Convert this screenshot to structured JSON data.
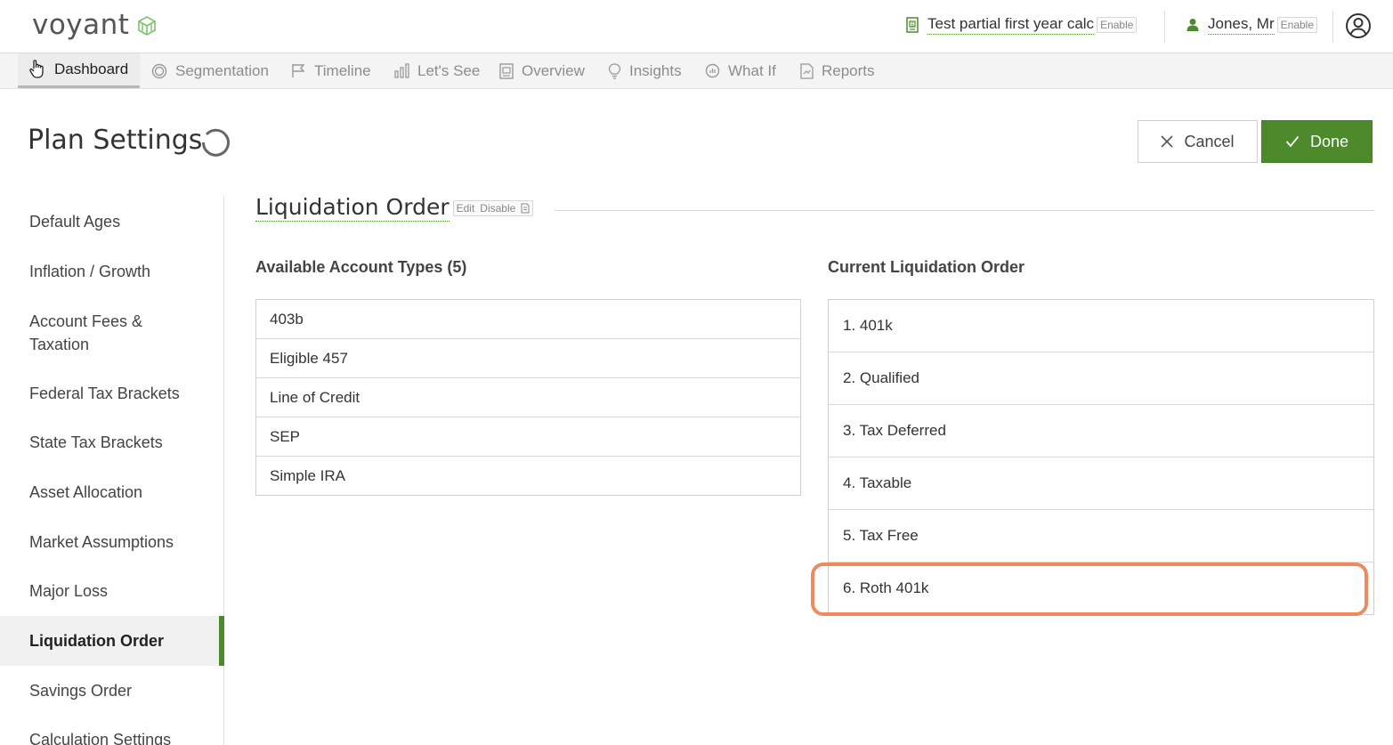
{
  "brand": {
    "name": "voyant"
  },
  "header": {
    "plan_name": "Test partial first year calc",
    "plan_enable": "Enable",
    "client_name": "Jones, Mr",
    "client_enable": "Enable"
  },
  "nav": {
    "tabs": [
      {
        "label": "Dashboard",
        "icon": "cursor-hand-icon",
        "active": true
      },
      {
        "label": "Segmentation",
        "icon": "segmentation-icon"
      },
      {
        "label": "Timeline",
        "icon": "flag-icon"
      },
      {
        "label": "Let's See",
        "icon": "bar-chart-icon"
      },
      {
        "label": "Overview",
        "icon": "overview-icon"
      },
      {
        "label": "Insights",
        "icon": "lightbulb-icon"
      },
      {
        "label": "What If",
        "icon": "what-if-icon"
      },
      {
        "label": "Reports",
        "icon": "document-icon"
      }
    ]
  },
  "page": {
    "title": "Plan Settings",
    "cancel_label": "Cancel",
    "done_label": "Done"
  },
  "sidebar": {
    "items": [
      {
        "label": "Default Ages"
      },
      {
        "label": "Inflation / Growth"
      },
      {
        "label": "Account Fees & Taxation"
      },
      {
        "label": "Federal Tax Brackets"
      },
      {
        "label": "State Tax Brackets"
      },
      {
        "label": "Asset Allocation"
      },
      {
        "label": "Market Assumptions"
      },
      {
        "label": "Major Loss"
      },
      {
        "label": "Liquidation Order",
        "active": true
      },
      {
        "label": "Savings Order"
      },
      {
        "label": "Calculation Settings"
      }
    ]
  },
  "section": {
    "title": "Liquidation Order",
    "edit_label": "Edit",
    "disable_label": "Disable"
  },
  "available": {
    "heading": "Available Account Types (5)",
    "items": [
      "403b",
      "Eligible 457",
      "Line of Credit",
      "SEP",
      "Simple IRA"
    ]
  },
  "current": {
    "heading": "Current Liquidation Order",
    "items": [
      "1. 401k",
      "2. Qualified",
      "3. Tax Deferred",
      "4. Taxable",
      "5. Tax Free",
      "6. Roth 401k"
    ]
  },
  "colors": {
    "brand_green": "#4c8a2b",
    "highlight_orange": "#ef8a5f"
  }
}
